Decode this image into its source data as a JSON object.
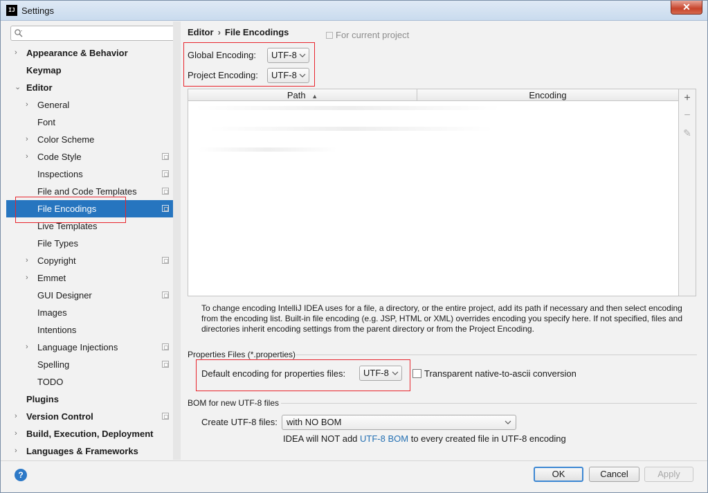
{
  "window": {
    "title": "Settings",
    "app_icon": "IJ",
    "close_label": "✕"
  },
  "search": {
    "placeholder": "",
    "value": ""
  },
  "sidebar": {
    "items": [
      {
        "label": "Appearance & Behavior",
        "bold": true,
        "arrow": "›",
        "level": 0
      },
      {
        "label": "Keymap",
        "bold": true,
        "level": 0
      },
      {
        "label": "Editor",
        "bold": true,
        "arrow": "⌄",
        "level": 0
      },
      {
        "label": "General",
        "arrow": "›",
        "level": 1
      },
      {
        "label": "Font",
        "level": 1
      },
      {
        "label": "Color Scheme",
        "arrow": "›",
        "level": 1
      },
      {
        "label": "Code Style",
        "arrow": "›",
        "level": 1,
        "icon": true
      },
      {
        "label": "Inspections",
        "level": 1,
        "icon": true
      },
      {
        "label": "File and Code Templates",
        "level": 1,
        "icon": true
      },
      {
        "label": "File Encodings",
        "level": 1,
        "icon": true,
        "selected": true
      },
      {
        "label": "Live Templates",
        "level": 1
      },
      {
        "label": "File Types",
        "level": 1
      },
      {
        "label": "Copyright",
        "arrow": "›",
        "level": 1,
        "icon": true
      },
      {
        "label": "Emmet",
        "arrow": "›",
        "level": 1
      },
      {
        "label": "GUI Designer",
        "level": 1,
        "icon": true
      },
      {
        "label": "Images",
        "level": 1
      },
      {
        "label": "Intentions",
        "level": 1
      },
      {
        "label": "Language Injections",
        "arrow": "›",
        "level": 1,
        "icon": true
      },
      {
        "label": "Spelling",
        "level": 1,
        "icon": true
      },
      {
        "label": "TODO",
        "level": 1
      },
      {
        "label": "Plugins",
        "bold": true,
        "level": 0
      },
      {
        "label": "Version Control",
        "bold": true,
        "arrow": "›",
        "level": 0,
        "icon": true
      },
      {
        "label": "Build, Execution, Deployment",
        "bold": true,
        "arrow": "›",
        "level": 0
      },
      {
        "label": "Languages & Frameworks",
        "bold": true,
        "arrow": "›",
        "level": 0
      }
    ]
  },
  "breadcrumb": {
    "parent": "Editor",
    "separator": "›",
    "current": "File Encodings"
  },
  "for_current_project": "For current project",
  "global_encoding": {
    "label": "Global Encoding:",
    "value": "UTF-8"
  },
  "project_encoding": {
    "label": "Project Encoding:",
    "value": "UTF-8"
  },
  "table": {
    "col_path": "Path",
    "sort_indicator": "▲",
    "col_encoding": "Encoding"
  },
  "table_tools": {
    "add": "+",
    "remove": "−",
    "edit": "✎"
  },
  "help_text": "To change encoding IntelliJ IDEA uses for a file, a directory, or the entire project, add its path if necessary and then select encoding from the encoding list. Built-in file encoding (e.g. JSP, HTML or XML) overrides encoding you specify here. If not specified, files and directories inherit encoding settings from the parent directory or from the Project Encoding.",
  "properties": {
    "section_title": "Properties Files (*.properties)",
    "default_label": "Default encoding for properties files:",
    "default_value": "UTF-8",
    "transparent_label": "Transparent native-to-ascii conversion",
    "transparent_checked": false
  },
  "bom": {
    "section_title": "BOM for new UTF-8 files",
    "create_label": "Create UTF-8 files:",
    "create_value": "with NO BOM",
    "note_prefix": "IDEA will NOT add ",
    "note_link": "UTF-8 BOM",
    "note_suffix": " to every created file in UTF-8 encoding"
  },
  "buttons": {
    "help": "?",
    "ok": "OK",
    "cancel": "Cancel",
    "apply": "Apply"
  },
  "colors": {
    "selection": "#2675bf",
    "highlight_box": "#e8242c",
    "link": "#2470b3"
  }
}
